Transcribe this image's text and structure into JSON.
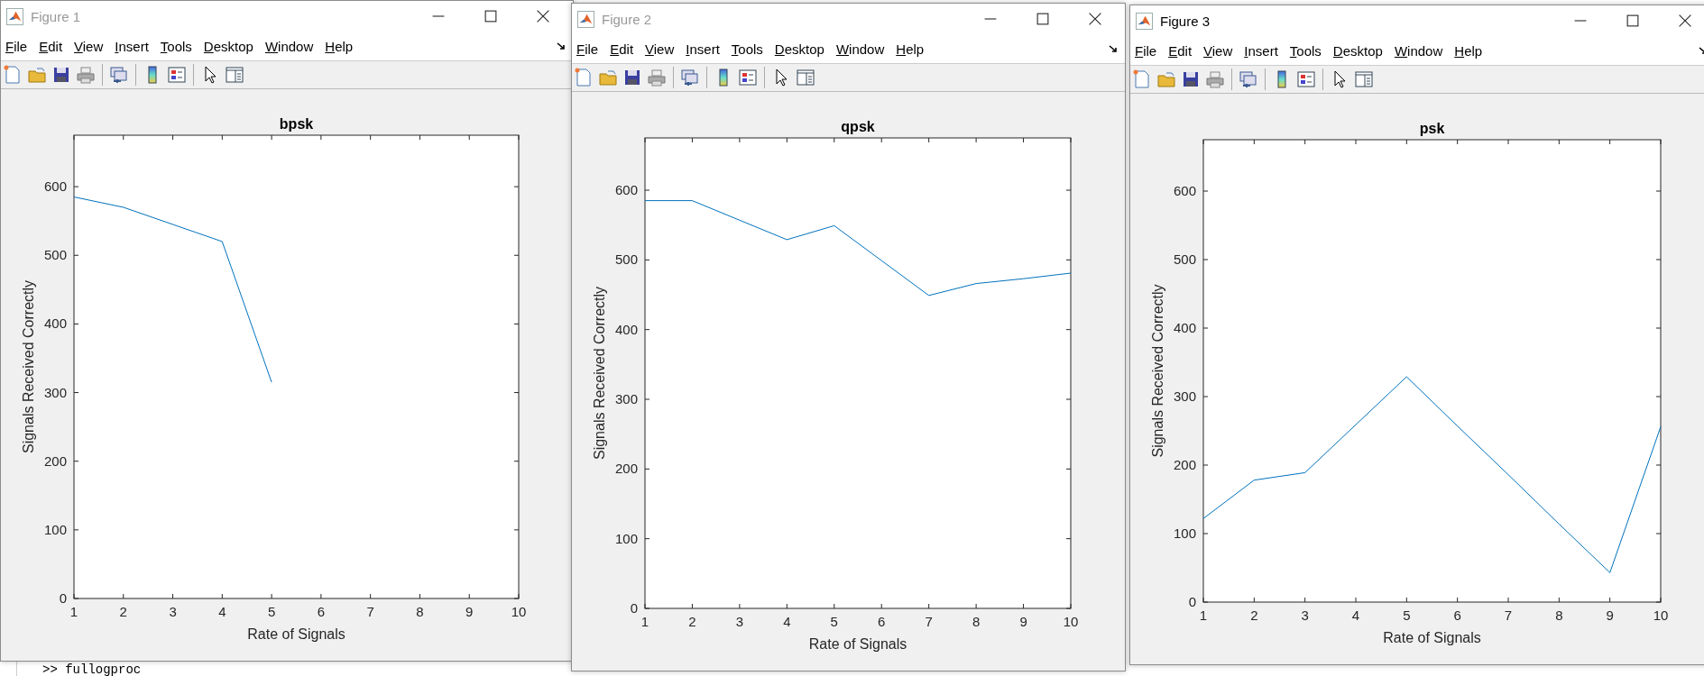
{
  "windows": [
    {
      "title": "Figure 1",
      "active": false,
      "menu": [
        "File",
        "Edit",
        "View",
        "Insert",
        "Tools",
        "Desktop",
        "Window",
        "Help"
      ],
      "chart_data": {
        "type": "line",
        "title": "bpsk",
        "xlabel": "Rate of Signals",
        "ylabel": "Signals Received Correctly",
        "x": [
          1,
          2,
          3,
          4,
          5
        ],
        "series": [
          {
            "values": [
              585,
              570,
              545,
              520,
              315
            ]
          }
        ],
        "xlim": [
          1,
          10
        ],
        "ylim": [
          0,
          675
        ],
        "xticks": [
          1,
          2,
          3,
          4,
          5,
          6,
          7,
          8,
          9,
          10
        ],
        "yticks": [
          0,
          100,
          200,
          300,
          400,
          500,
          600
        ]
      }
    },
    {
      "title": "Figure 2",
      "active": false,
      "menu": [
        "File",
        "Edit",
        "View",
        "Insert",
        "Tools",
        "Desktop",
        "Window",
        "Help"
      ],
      "chart_data": {
        "type": "line",
        "title": "qpsk",
        "xlabel": "Rate of Signals",
        "ylabel": "Signals Received Correctly",
        "x": [
          1,
          2,
          3,
          4,
          5,
          6,
          7,
          8,
          9,
          10
        ],
        "series": [
          {
            "values": [
              585,
              585,
              557,
              529,
              549,
              499,
              449,
              466,
              473,
              481
            ]
          }
        ],
        "xlim": [
          1,
          10
        ],
        "ylim": [
          0,
          675
        ],
        "xticks": [
          1,
          2,
          3,
          4,
          5,
          6,
          7,
          8,
          9,
          10
        ],
        "yticks": [
          0,
          100,
          200,
          300,
          400,
          500,
          600
        ]
      }
    },
    {
      "title": "Figure 3",
      "active": true,
      "menu": [
        "File",
        "Edit",
        "View",
        "Insert",
        "Tools",
        "Desktop",
        "Window",
        "Help"
      ],
      "chart_data": {
        "type": "line",
        "title": "psk",
        "xlabel": "Rate of Signals",
        "ylabel": "Signals Received Correctly",
        "x": [
          1,
          2,
          3,
          4,
          5,
          6,
          7,
          8,
          9,
          10
        ],
        "series": [
          {
            "values": [
              122,
              178,
              189,
              259,
              329,
              257,
              186,
              114,
              43,
              256
            ]
          }
        ],
        "xlim": [
          1,
          10
        ],
        "ylim": [
          0,
          675
        ],
        "xticks": [
          1,
          2,
          3,
          4,
          5,
          6,
          7,
          8,
          9,
          10
        ],
        "yticks": [
          0,
          100,
          200,
          300,
          400,
          500,
          600
        ]
      }
    }
  ],
  "command_window": {
    "prompt_line": ">> fullogproc"
  }
}
